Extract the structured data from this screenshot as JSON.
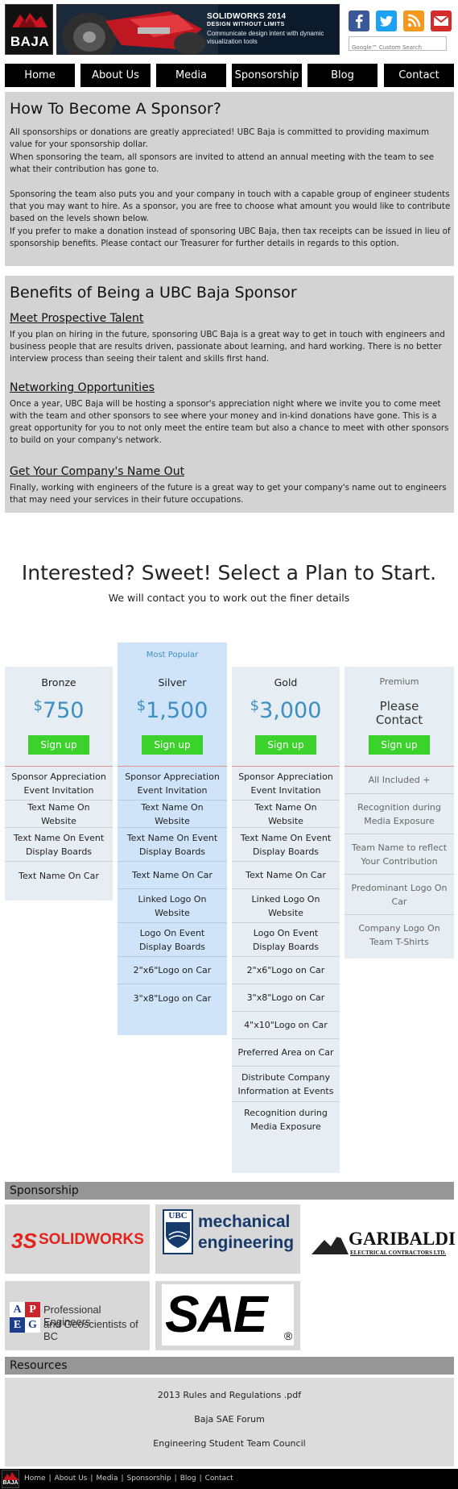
{
  "header": {
    "logo_text": "BAJA",
    "banner": {
      "line1": "SOLIDWORKS 2014",
      "line2": "DESIGN WITHOUT LIMITS",
      "line3": "Communicate design intent with dynamic visualization tools"
    },
    "social_icons": [
      "facebook-icon",
      "twitter-icon",
      "rss-icon",
      "mail-icon"
    ],
    "search_placeholder": "Google™ Custom Search",
    "colors": {
      "facebook": "#3b5998",
      "twitter": "#1da1f2",
      "rss": "#f39a1e",
      "mail": "#d42b2b"
    }
  },
  "nav": [
    "Home",
    "About Us",
    "Media",
    "Sponsorship",
    "Blog",
    "Contact"
  ],
  "become": {
    "title": "How To Become A Sponsor?",
    "p1": "All sponsorships or donations are greatly appreciated! UBC Baja is committed to providing maximum value for your sponsorship dollar.",
    "p2": "When sponsoring the team, all sponsors are invited to attend an annual meeting with the team to see what their contribution has gone to.",
    "p3": "Sponsoring the team also puts you and your company in touch with a capable group of engineer students that you may want to hire. As a sponsor, you are free to choose what amount you would like to contribute based on the levels shown below.",
    "p4": "If you prefer to make a donation instead of sponsoring UBC Baja, then tax receipts can be issued in lieu of sponsorship benefits. Please contact our Treasurer for further details in regards to this option."
  },
  "benefits": {
    "title": "Benefits of Being a UBC Baja Sponsor",
    "h1": "Meet Prospective Talent",
    "p1": "If you plan on hiring in the future, sponsoring UBC Baja is a great way to get in touch with engineers and business people that are results driven, passionate about learning, and hard working. There is no better interview process than seeing their talent and skills first hand.",
    "h2": "Networking Opportunities",
    "p2": "Once a year, UBC Baja will be hosting a sponsor's appreciation night where we invite you to come meet with the team and other sponsors to see where your money and in-kind donations have gone. This is a great opportunity for you to not only meet the entire team but also a chance to meet with other sponsors to build on your company's network.",
    "h3": "Get Your Company's Name Out",
    "p3": "Finally, working with engineers of the future is a great way to get your company's name out to engineers that may need your services in their future occupations."
  },
  "plans_intro": {
    "title": "Interested? Sweet! Select a Plan to Start.",
    "subtitle": "We will contact you to work out the finer details"
  },
  "plans": {
    "popular_label": "Most Popular",
    "signup_label": "Sign up",
    "currency": "$",
    "bronze": {
      "name": "Bronze",
      "price": "750",
      "features": [
        "Sponsor Appreciation Event Invitation",
        "Text Name On Website",
        "Text Name On Event Display Boards",
        "Text Name On Car"
      ]
    },
    "silver": {
      "name": "Silver",
      "price": "1,500",
      "features": [
        "Sponsor Appreciation Event Invitation",
        "Text Name On Website",
        "Text Name On Event Display Boards",
        "Text Name On Car",
        "Linked Logo On Website",
        "Logo On Event Display Boards",
        "2\"x6\"Logo on Car",
        "3\"x8\"Logo on Car"
      ]
    },
    "gold": {
      "name": "Gold",
      "price": "3,000",
      "features": [
        "Sponsor Appreciation Event Invitation",
        "Text Name On Website",
        "Text Name On Event Display Boards",
        "Text Name On Car",
        "Linked Logo On Website",
        "Logo On Event Display Boards",
        "2\"x6\"Logo on Car",
        "3\"x8\"Logo on Car",
        "4\"x10\"Logo on Car",
        "Preferred Area on Car",
        "Distribute Company Information at Events",
        "Recognition during Media Exposure"
      ]
    },
    "premium": {
      "name": "Premium",
      "price_text": "Please Contact",
      "features": [
        "All Included +",
        "Recognition during Media Exposure",
        "Team Name to reflect Your Contribution",
        "Predominant Logo On Car",
        "Company Logo On Team T-Shirts"
      ]
    }
  },
  "sponsorship": {
    "title": "Sponsorship",
    "logos": {
      "solidworks": "SOLIDWORKS",
      "ubc_short": "UBC",
      "ubc_line1": "mechanical",
      "ubc_line2": "engineering",
      "garibaldi_line1": "GARIBALDI",
      "garibaldi_line2": "ELECTRICAL CONTRACTORS LTD.",
      "apeg_line1": "Professional Engineers",
      "apeg_line2": "and Geoscientists of BC",
      "apeg_letters": [
        "A",
        "P",
        "E",
        "G"
      ],
      "sae": "SAE",
      "sae_reg": "®"
    }
  },
  "resources": {
    "title": "Resources",
    "links": [
      "2013 Rules and Regulations .pdf",
      "Baja SAE Forum",
      "Engineering Student Team Council"
    ]
  },
  "footer": {
    "logo_text": "BAJA",
    "links": [
      "Home",
      "About Us",
      "Media",
      "Sponsorship",
      "Blog",
      "Contact"
    ]
  }
}
